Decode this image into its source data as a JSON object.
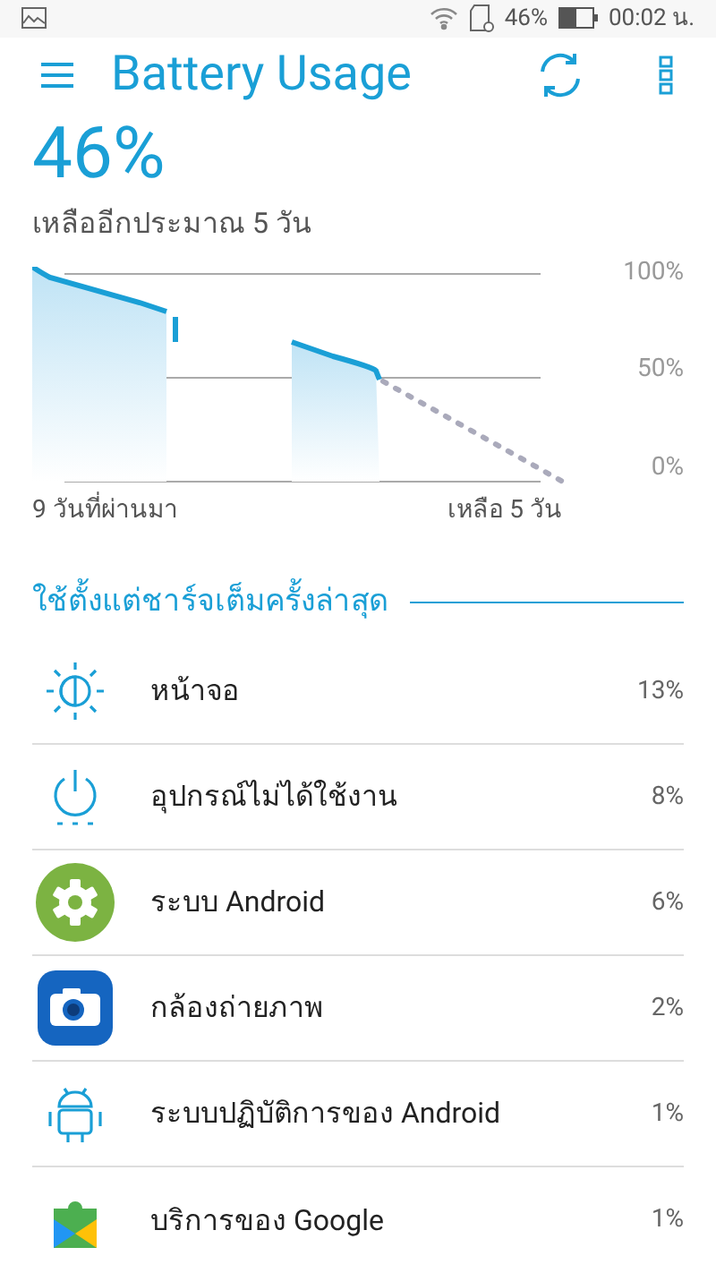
{
  "status_bar": {
    "battery_percent": "46%",
    "time": "00:02 น."
  },
  "toolbar": {
    "title": "Battery Usage"
  },
  "summary": {
    "level_text": "46%",
    "remaining": "เหลืออีกประมาณ 5 วัน"
  },
  "history": {
    "y_labels": [
      "100%",
      "50%",
      "0%"
    ],
    "x_start": "9 วันที่ผ่านมา",
    "x_end": "เหลือ 5 วัน"
  },
  "section": {
    "title": "ใช้ตั้งแต่ชาร์จเต็มครั้งล่าสุด"
  },
  "usage": [
    {
      "kind": "screen",
      "name": "หน้าจอ",
      "percent": "13%"
    },
    {
      "kind": "idle",
      "name": "อุปกรณ์ไม่ได้ใช้งาน",
      "percent": "8%"
    },
    {
      "kind": "settings",
      "name": "ระบบ Android",
      "percent": "6%"
    },
    {
      "kind": "camera",
      "name": "กล้องถ่ายภาพ",
      "percent": "2%"
    },
    {
      "kind": "android",
      "name": "ระบบปฏิบัติการของ Android",
      "percent": "1%"
    },
    {
      "kind": "puzzle",
      "name": "บริการของ Google",
      "percent": "1%"
    }
  ]
}
